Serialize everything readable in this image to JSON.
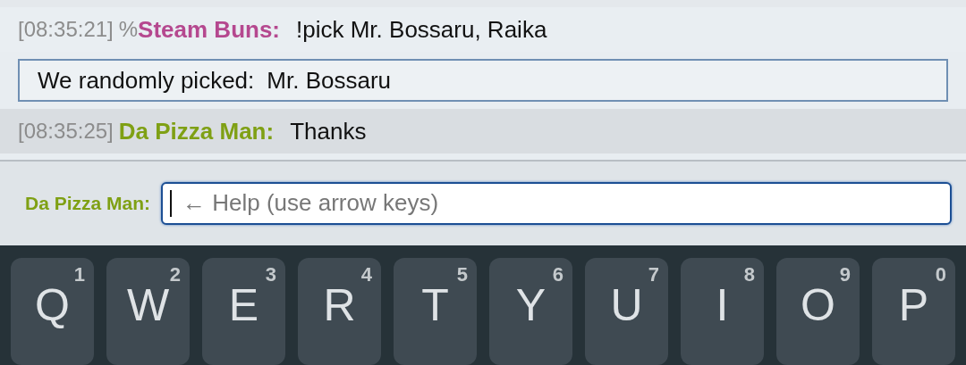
{
  "messages": [
    {
      "kind": "chat",
      "time": "[08:35:21]",
      "prefix": "%",
      "user": "Steam Buns:",
      "color": "#b5488f",
      "text": "!pick Mr. Bossaru, Raika"
    },
    {
      "kind": "notice",
      "label": "We randomly picked:",
      "text": "Mr. Bossaru"
    },
    {
      "kind": "chat",
      "time": "[08:35:25]",
      "user": "Da Pizza Man:",
      "color": "#7fa014",
      "text": "Thanks"
    }
  ],
  "composer": {
    "user": "Da Pizza Man:",
    "placeholder": "← Help (use arrow keys)"
  },
  "keyboard": [
    {
      "letter": "Q",
      "hint": "1"
    },
    {
      "letter": "W",
      "hint": "2"
    },
    {
      "letter": "E",
      "hint": "3"
    },
    {
      "letter": "R",
      "hint": "4"
    },
    {
      "letter": "T",
      "hint": "5"
    },
    {
      "letter": "Y",
      "hint": "6"
    },
    {
      "letter": "U",
      "hint": "7"
    },
    {
      "letter": "I",
      "hint": "8"
    },
    {
      "letter": "O",
      "hint": "9"
    },
    {
      "letter": "P",
      "hint": "0"
    }
  ]
}
